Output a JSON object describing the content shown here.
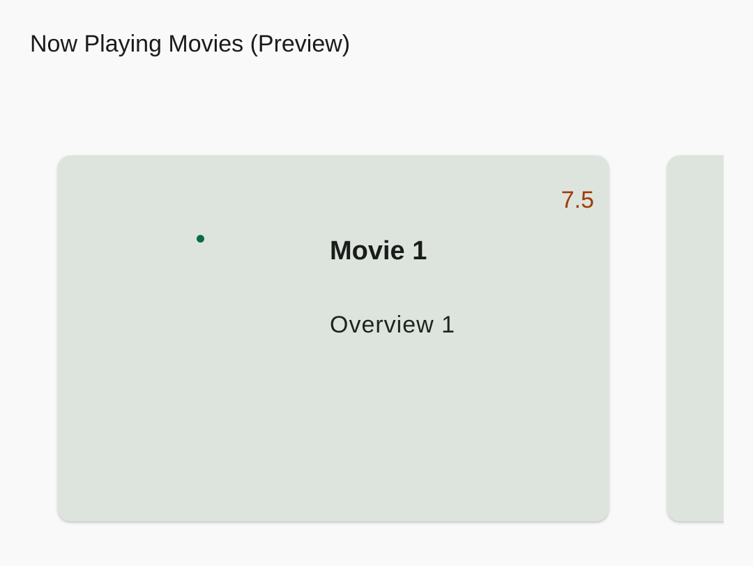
{
  "header": {
    "title": "Now Playing Movies (Preview)"
  },
  "movies": [
    {
      "rating": "7.5",
      "title": "Movie 1",
      "overview": "Overview 1"
    }
  ],
  "colors": {
    "background": "#f9f9f9",
    "card": "#dde4dd",
    "rating": "#a03c06",
    "loader": "#0a6b45",
    "text": "#1a1c1a"
  }
}
